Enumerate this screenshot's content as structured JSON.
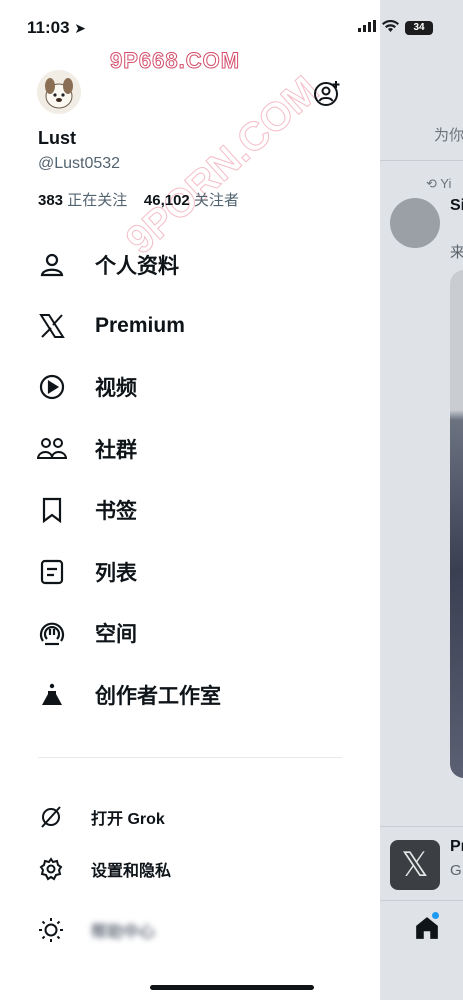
{
  "status_bar": {
    "time": "11:03",
    "battery": "34"
  },
  "watermarks": {
    "top": "9P668.COM",
    "diagonal": "9PORN.COM"
  },
  "profile": {
    "display_name": "Lust",
    "handle": "@Lust0532",
    "following_count": "383",
    "following_label": "正在关注",
    "followers_count": "46,102",
    "followers_label": "关注者"
  },
  "menu": {
    "items": [
      {
        "label": "个人资料",
        "icon": "person-icon"
      },
      {
        "label": "Premium",
        "icon": "x-logo-icon"
      },
      {
        "label": "视频",
        "icon": "play-circle-icon"
      },
      {
        "label": "社群",
        "icon": "communities-icon"
      },
      {
        "label": "书签",
        "icon": "bookmark-icon"
      },
      {
        "label": "列表",
        "icon": "list-icon"
      },
      {
        "label": "空间",
        "icon": "spaces-icon"
      },
      {
        "label": "创作者工作室",
        "icon": "flask-icon"
      }
    ]
  },
  "secondary": {
    "grok": "打开 Grok",
    "settings": "设置和隐私",
    "help": "帮助中心"
  },
  "background_feed": {
    "tab_label": "为你",
    "retweet_prefix": "Yi",
    "author_prefix": "Si",
    "line_prefix": "来",
    "promo_prefix": "Pr",
    "promo_sub": "G"
  },
  "colors": {
    "accent": "#1d9bf0",
    "text": "#0f1419",
    "muted": "#536471"
  }
}
